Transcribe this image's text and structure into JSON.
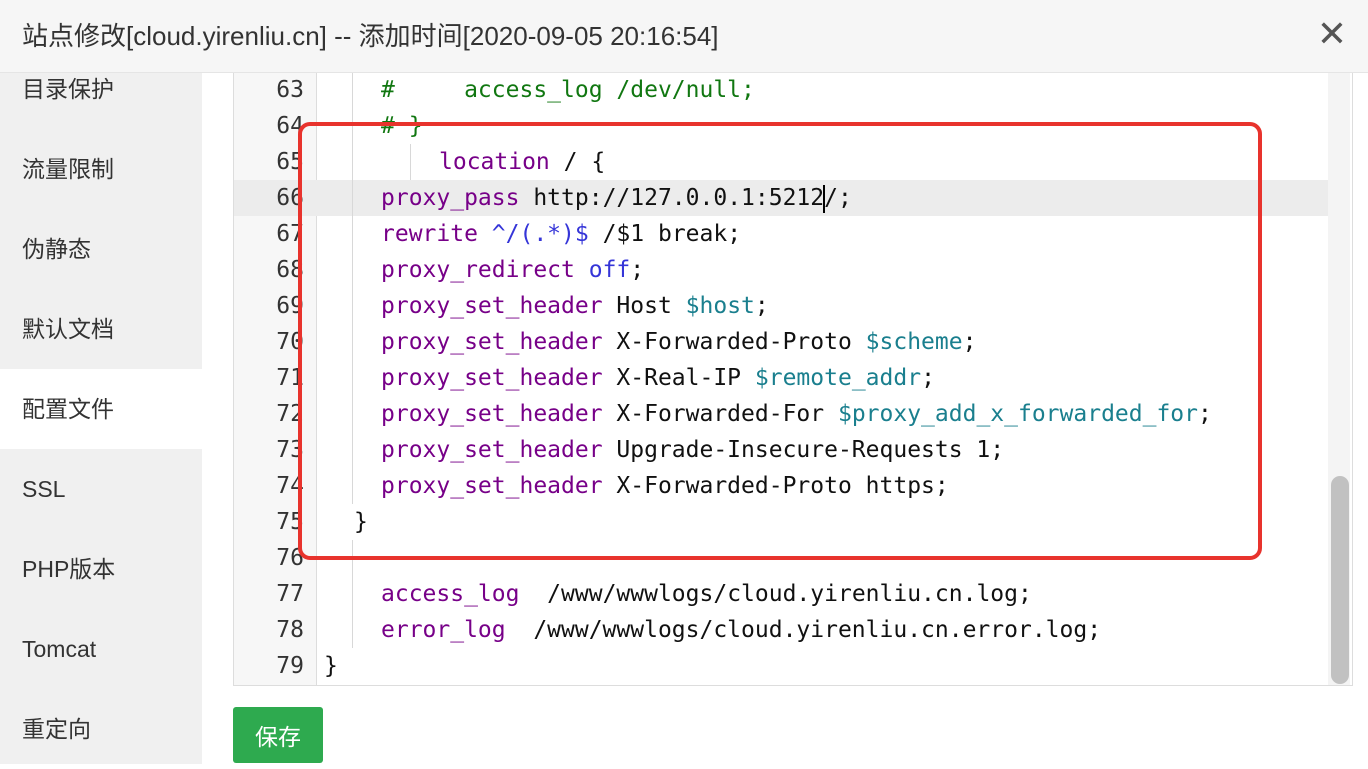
{
  "dialog": {
    "title": "站点修改[cloud.yirenliu.cn] -- 添加时间[2020-09-05 20:16:54]",
    "close_icon": "close-icon",
    "close_glyph": "✕"
  },
  "sidebar": {
    "items": [
      {
        "label": "目录保护"
      },
      {
        "label": "流量限制"
      },
      {
        "label": "伪静态"
      },
      {
        "label": "默认文档"
      },
      {
        "label": "配置文件",
        "active": true
      },
      {
        "label": "SSL"
      },
      {
        "label": "PHP版本"
      },
      {
        "label": "Tomcat"
      },
      {
        "label": "重定向"
      }
    ]
  },
  "editor": {
    "cursor_line": 66,
    "lines": [
      {
        "n": "63",
        "tokens": [
          {
            "c": "cm",
            "t": "#     access_log /dev/null;"
          }
        ]
      },
      {
        "n": "64",
        "tokens": [
          {
            "c": "cm",
            "t": "# }"
          }
        ]
      },
      {
        "n": "65",
        "tokens": [
          {
            "c": "kw",
            "t": "location"
          },
          {
            "c": "pl",
            "t": " / {"
          }
        ]
      },
      {
        "n": "66",
        "tokens": [
          {
            "c": "kw",
            "t": "proxy_pass"
          },
          {
            "c": "pl",
            "t": " http://127.0.0.1:5212"
          },
          {
            "c": "cursor",
            "t": ""
          },
          {
            "c": "pl",
            "t": "/;"
          }
        ]
      },
      {
        "n": "67",
        "tokens": [
          {
            "c": "kw",
            "t": "rewrite"
          },
          {
            "c": "pl",
            "t": " "
          },
          {
            "c": "builtin",
            "t": "^/(.*)$"
          },
          {
            "c": "pl",
            "t": " /$1 break;"
          }
        ]
      },
      {
        "n": "68",
        "tokens": [
          {
            "c": "kw",
            "t": "proxy_redirect"
          },
          {
            "c": "pl",
            "t": " "
          },
          {
            "c": "builtin",
            "t": "off"
          },
          {
            "c": "pl",
            "t": ";"
          }
        ]
      },
      {
        "n": "69",
        "tokens": [
          {
            "c": "kw",
            "t": "proxy_set_header"
          },
          {
            "c": "pl",
            "t": " Host "
          },
          {
            "c": "var",
            "t": "$host"
          },
          {
            "c": "pl",
            "t": ";"
          }
        ]
      },
      {
        "n": "70",
        "tokens": [
          {
            "c": "kw",
            "t": "proxy_set_header"
          },
          {
            "c": "pl",
            "t": " X-Forwarded-Proto "
          },
          {
            "c": "var",
            "t": "$scheme"
          },
          {
            "c": "pl",
            "t": ";"
          }
        ]
      },
      {
        "n": "71",
        "tokens": [
          {
            "c": "kw",
            "t": "proxy_set_header"
          },
          {
            "c": "pl",
            "t": " X-Real-IP "
          },
          {
            "c": "var",
            "t": "$remote_addr"
          },
          {
            "c": "pl",
            "t": ";"
          }
        ]
      },
      {
        "n": "72",
        "tokens": [
          {
            "c": "kw",
            "t": "proxy_set_header"
          },
          {
            "c": "pl",
            "t": " X-Forwarded-For "
          },
          {
            "c": "var",
            "t": "$proxy_add_x_forwarded_for"
          },
          {
            "c": "pl",
            "t": ";"
          }
        ]
      },
      {
        "n": "73",
        "tokens": [
          {
            "c": "kw",
            "t": "proxy_set_header"
          },
          {
            "c": "pl",
            "t": " Upgrade-Insecure-Requests 1;"
          }
        ]
      },
      {
        "n": "74",
        "tokens": [
          {
            "c": "kw",
            "t": "proxy_set_header"
          },
          {
            "c": "pl",
            "t": " X-Forwarded-Proto https;"
          }
        ]
      },
      {
        "n": "75",
        "tokens": [
          {
            "c": "pl",
            "t": "}"
          }
        ]
      },
      {
        "n": "76",
        "tokens": []
      },
      {
        "n": "77",
        "tokens": [
          {
            "c": "kw",
            "t": "access_log"
          },
          {
            "c": "pl",
            "t": "  /www/wwwlogs/cloud.yirenliu.cn.log;"
          }
        ]
      },
      {
        "n": "78",
        "tokens": [
          {
            "c": "kw",
            "t": "error_log"
          },
          {
            "c": "pl",
            "t": "  /www/wwwlogs/cloud.yirenliu.cn.error.log;"
          }
        ]
      },
      {
        "n": "79",
        "tokens": [
          {
            "c": "pl",
            "t": "}"
          }
        ]
      }
    ]
  },
  "actions": {
    "save_label": "保存"
  }
}
